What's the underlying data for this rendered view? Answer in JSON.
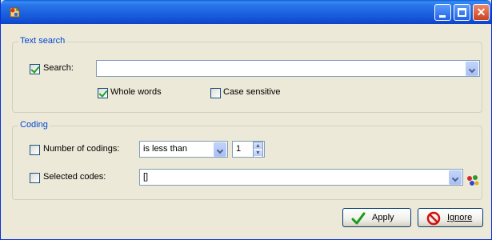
{
  "window": {
    "controls": {
      "minimize": "",
      "maximize": "",
      "close": "✕"
    }
  },
  "text_search": {
    "group_label": "Text search",
    "search": {
      "label": "Search:",
      "checked": true,
      "value": "",
      "placeholder": ""
    },
    "whole_words": {
      "label": "Whole words",
      "checked": true
    },
    "case_sensitive": {
      "label": "Case sensitive",
      "checked": false
    }
  },
  "coding": {
    "group_label": "Coding",
    "number_of_codings": {
      "label": "Number of codings:",
      "checked": false,
      "operator": "is less than",
      "value": "1"
    },
    "selected_codes": {
      "label": "Selected codes:",
      "checked": false,
      "value": "[]"
    }
  },
  "buttons": {
    "apply": {
      "label": "Apply",
      "icon": "checkmark-icon",
      "color": "#1a9a1a"
    },
    "ignore": {
      "label": "Ignore",
      "icon": "no-entry-icon",
      "color": "#d01010"
    }
  },
  "colors": {
    "titlebar": "#1b62de",
    "group_label": "#0046d5",
    "face": "#ece9d8"
  }
}
